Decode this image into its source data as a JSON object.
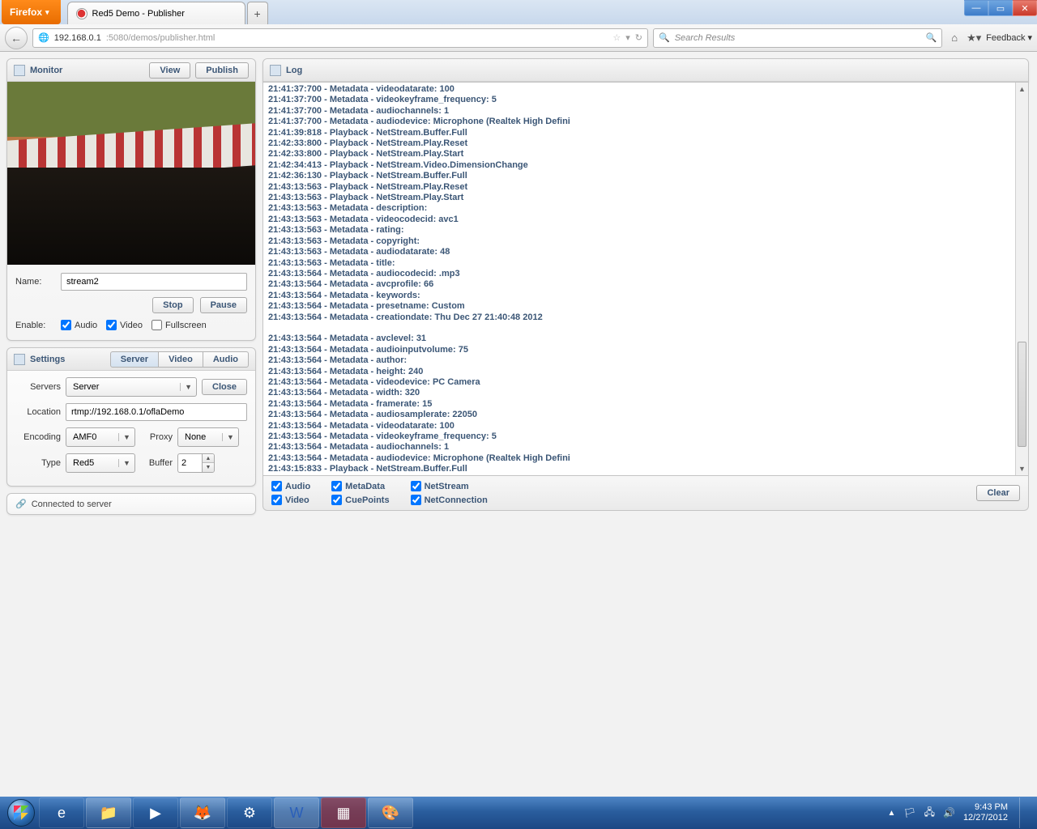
{
  "browser": {
    "name": "Firefox",
    "tab_title": "Red5 Demo - Publisher",
    "url_host": "192.168.0.1",
    "url_rest": ":5080/demos/publisher.html",
    "search_placeholder": "Search Results",
    "feedback": "Feedback"
  },
  "monitor": {
    "title": "Monitor",
    "view": "View",
    "publish": "Publish",
    "name_label": "Name:",
    "name_value": "stream2",
    "stop": "Stop",
    "pause": "Pause",
    "enable_label": "Enable:",
    "audio": "Audio",
    "video": "Video",
    "fullscreen": "Fullscreen"
  },
  "settings": {
    "title": "Settings",
    "tabs": {
      "server": "Server",
      "video": "Video",
      "audio": "Audio"
    },
    "servers_label": "Servers",
    "servers_value": "Server",
    "close": "Close",
    "location_label": "Location",
    "location_value": "rtmp://192.168.0.1/oflaDemo",
    "encoding_label": "Encoding",
    "encoding_value": "AMF0",
    "proxy_label": "Proxy",
    "proxy_value": "None",
    "type_label": "Type",
    "type_value": "Red5",
    "buffer_label": "Buffer",
    "buffer_value": "2"
  },
  "status": {
    "text": "Connected to server"
  },
  "log": {
    "title": "Log",
    "filters": {
      "audio": "Audio",
      "metadata": "MetaData",
      "netstream": "NetStream",
      "video": "Video",
      "cuepoints": "CuePoints",
      "netconnection": "NetConnection"
    },
    "clear": "Clear",
    "lines": [
      "21:41:37:700 - Metadata - videodatarate: 100",
      "21:41:37:700 - Metadata - videokeyframe_frequency: 5",
      "21:41:37:700 - Metadata - audiochannels: 1",
      "21:41:37:700 - Metadata - audiodevice: Microphone (Realtek High Defini",
      "21:41:39:818 - Playback - NetStream.Buffer.Full",
      "21:42:33:800 - Playback - NetStream.Play.Reset",
      "21:42:33:800 - Playback - NetStream.Play.Start",
      "21:42:34:413 - Playback - NetStream.Video.DimensionChange",
      "21:42:36:130 - Playback - NetStream.Buffer.Full",
      "21:43:13:563 - Playback - NetStream.Play.Reset",
      "21:43:13:563 - Playback - NetStream.Play.Start",
      "21:43:13:563 - Metadata - description:",
      "21:43:13:563 - Metadata - videocodecid: avc1",
      "21:43:13:563 - Metadata - rating:",
      "21:43:13:563 - Metadata - copyright:",
      "21:43:13:563 - Metadata - audiodatarate: 48",
      "21:43:13:563 - Metadata - title:",
      "21:43:13:564 - Metadata - audiocodecid: .mp3",
      "21:43:13:564 - Metadata - avcprofile: 66",
      "21:43:13:564 - Metadata - keywords:",
      "21:43:13:564 - Metadata - presetname: Custom",
      "21:43:13:564 - Metadata - creationdate: Thu Dec 27 21:40:48 2012",
      "",
      "21:43:13:564 - Metadata - avclevel: 31",
      "21:43:13:564 - Metadata - audioinputvolume: 75",
      "21:43:13:564 - Metadata - author:",
      "21:43:13:564 - Metadata - height: 240",
      "21:43:13:564 - Metadata - videodevice: PC Camera",
      "21:43:13:564 - Metadata - width: 320",
      "21:43:13:564 - Metadata - framerate: 15",
      "21:43:13:564 - Metadata - audiosamplerate: 22050",
      "21:43:13:564 - Metadata - videodatarate: 100",
      "21:43:13:564 - Metadata - videokeyframe_frequency: 5",
      "21:43:13:564 - Metadata - audiochannels: 1",
      "21:43:13:564 - Metadata - audiodevice: Microphone (Realtek High Defini",
      "21:43:15:833 - Playback - NetStream.Buffer.Full"
    ]
  },
  "taskbar": {
    "time": "9:43 PM",
    "date": "12/27/2012"
  }
}
